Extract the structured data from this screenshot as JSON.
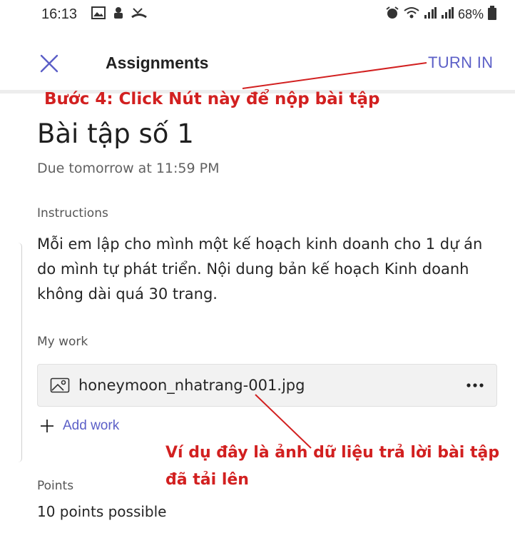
{
  "status_bar": {
    "time": "16:13",
    "battery": "68%",
    "left_icons": [
      "gallery-icon",
      "android-app-icon",
      "missed-call-icon"
    ],
    "right_icons": [
      "alarm-icon",
      "wifi-icon",
      "signal-icon",
      "signal-icon",
      "battery-icon"
    ]
  },
  "header": {
    "close_icon": "close-icon",
    "title": "Assignments",
    "turn_in_label": "TURN IN",
    "accent_color": "#5b5fc7"
  },
  "assignment": {
    "title": "Bài tập số 1",
    "due": "Due tomorrow at 11:59 PM",
    "instructions_label": "Instructions",
    "instructions_text": "Mỗi em lập cho mình một kế hoạch kinh doanh cho 1 dự án do mình tự phát triển. Nội dung bản kế hoạch Kinh doanh không dài quá 30 trang.",
    "my_work_label": "My work",
    "file": {
      "icon": "image-icon",
      "name": "honeymoon_nhatrang-001.jpg",
      "more_icon": "more-icon"
    },
    "add_work_label": "Add work",
    "points_label": "Points",
    "points_text": "10 points possible"
  },
  "annotations": {
    "color": "#d22020",
    "step4": "Bước 4: Click Nút này để nộp bài tập",
    "example": "Ví dụ đây là ảnh dữ liệu trả lời bài tập đã tải lên"
  }
}
